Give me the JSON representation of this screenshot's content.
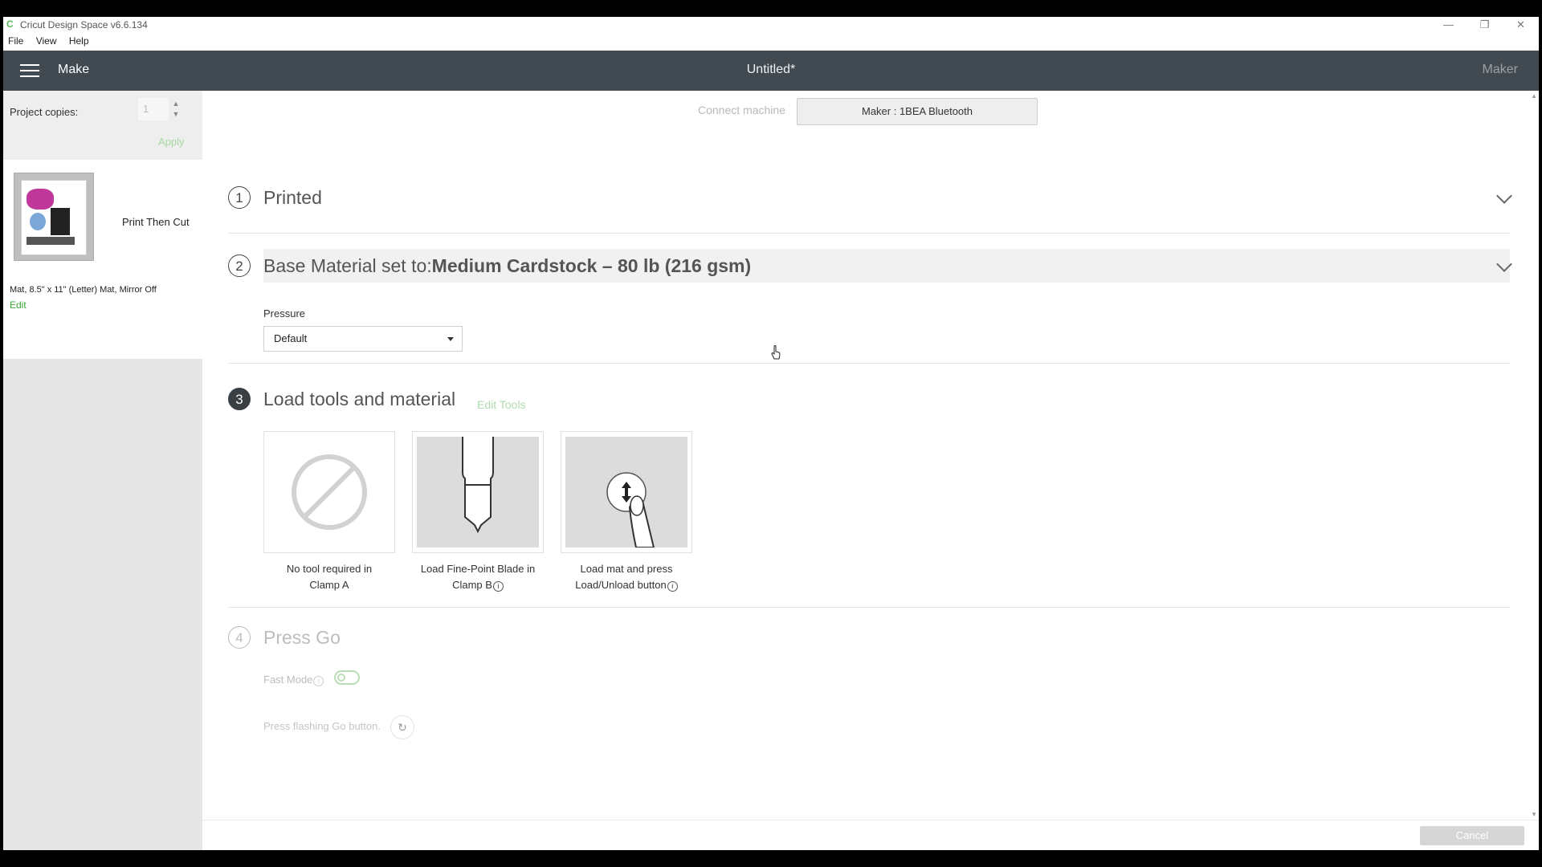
{
  "window": {
    "title": "Cricut Design Space  v6.6.134",
    "app_icon": "C",
    "controls": [
      "—",
      "❐",
      "✕"
    ]
  },
  "menu": [
    "File",
    "View",
    "Help"
  ],
  "header": {
    "section": "Make",
    "document_title": "Untitled*",
    "machine": "Maker"
  },
  "left_panel": {
    "copies_label": "Project copies:",
    "copies_value": "1",
    "apply_label": "Apply",
    "mat": {
      "mode": "Print Then Cut",
      "info": "Mat, 8.5\" x 11\" (Letter) Mat, Mirror Off",
      "edit_label": "Edit"
    }
  },
  "connect": {
    "label": "Connect machine",
    "button": "Maker : 1BEA Bluetooth"
  },
  "steps": [
    {
      "num": "1",
      "title": "Printed"
    },
    {
      "num": "2",
      "title_prefix": "Base Material set to:",
      "title_value": "Medium Cardstock – 80 lb (216 gsm)"
    },
    {
      "num": "3",
      "title": "Load tools and material",
      "edit_tools": "Edit Tools"
    },
    {
      "num": "4",
      "title": "Press Go"
    }
  ],
  "pressure": {
    "label": "Pressure",
    "value": "Default"
  },
  "tools": [
    {
      "line1": "No tool required in",
      "line2": "Clamp A"
    },
    {
      "line1": "Load Fine-Point Blade in",
      "line2": "Clamp B"
    },
    {
      "line1": "Load mat and press",
      "line2": "Load/Unload button"
    }
  ],
  "press_go": {
    "fast_mode_label": "Fast Mode",
    "fast_mode_on": false,
    "instruction": "Press flashing Go button."
  },
  "footer": {
    "cancel_label": "Cancel"
  },
  "colors": {
    "header_bg": "#414a51",
    "accent_green": "#3ba635"
  }
}
